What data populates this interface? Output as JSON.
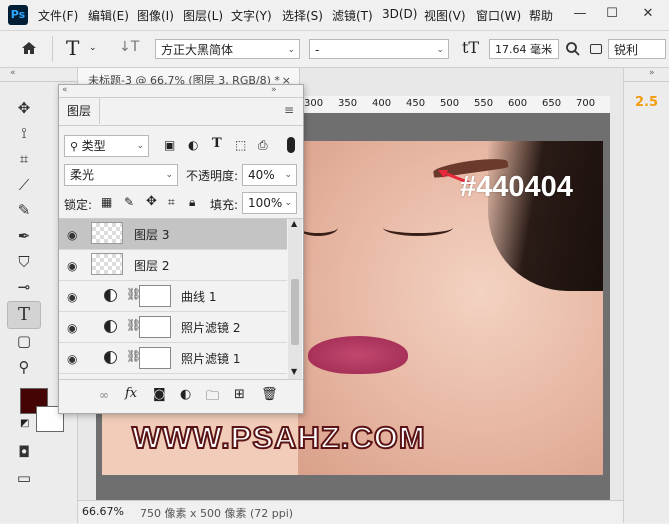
{
  "app": {
    "logo": "Ps"
  },
  "menu": [
    "文件(F)",
    "编辑(E)",
    "图像(I)",
    "图层(L)",
    "文字(Y)",
    "选择(S)",
    "滤镜(T)",
    "3D(D)",
    "视图(V)",
    "窗口(W)",
    "帮助"
  ],
  "window_controls": [
    "—",
    "☐",
    "✕"
  ],
  "options": {
    "home_icon": "home-icon",
    "text_tool_glyph": "T",
    "orientation_glyph": "↓T",
    "font_family": "方正大黑简体",
    "font_style": "-",
    "size_glyph": "tT",
    "font_size": "17.64 毫米",
    "antialias": "锐利"
  },
  "document": {
    "tab_title": "未标题-3 @ 66.7% (图层 3, RGB/8) *",
    "close": "×",
    "ruler_ticks": [
      "300",
      "350",
      "400",
      "450",
      "500",
      "550",
      "600",
      "650",
      "700"
    ],
    "annotation": "#440404",
    "watermark": "WWW.PSAHZ.COM",
    "zoom": "66.67%",
    "doc_info": "750 像素 x 500 像素 (72 ppi)"
  },
  "right_panel": {
    "value": "2.5"
  },
  "colors": {
    "foreground": "#440404",
    "background": "#ffffff",
    "annotation": "#ffffff",
    "arrow": "#e8293a"
  },
  "layers_panel": {
    "tab": "图层",
    "filter_label": "类型",
    "blend_mode": "柔光",
    "opacity_label": "不透明度:",
    "opacity": "40%",
    "lock_label": "锁定:",
    "fill_label": "填充:",
    "fill": "100%",
    "layers": [
      {
        "name": "图层 3",
        "type": "pixel",
        "selected": true
      },
      {
        "name": "图层 2",
        "type": "pixel",
        "selected": false
      },
      {
        "name": "曲线 1",
        "type": "adjustment",
        "selected": false
      },
      {
        "name": "照片滤镜 2",
        "type": "adjustment",
        "selected": false
      },
      {
        "name": "照片滤镜 1",
        "type": "adjustment",
        "selected": false
      }
    ],
    "footer_icons": [
      "link-icon",
      "fx-icon",
      "mask-icon",
      "adjustment-icon",
      "folder-icon",
      "new-layer-icon",
      "trash-icon"
    ]
  }
}
